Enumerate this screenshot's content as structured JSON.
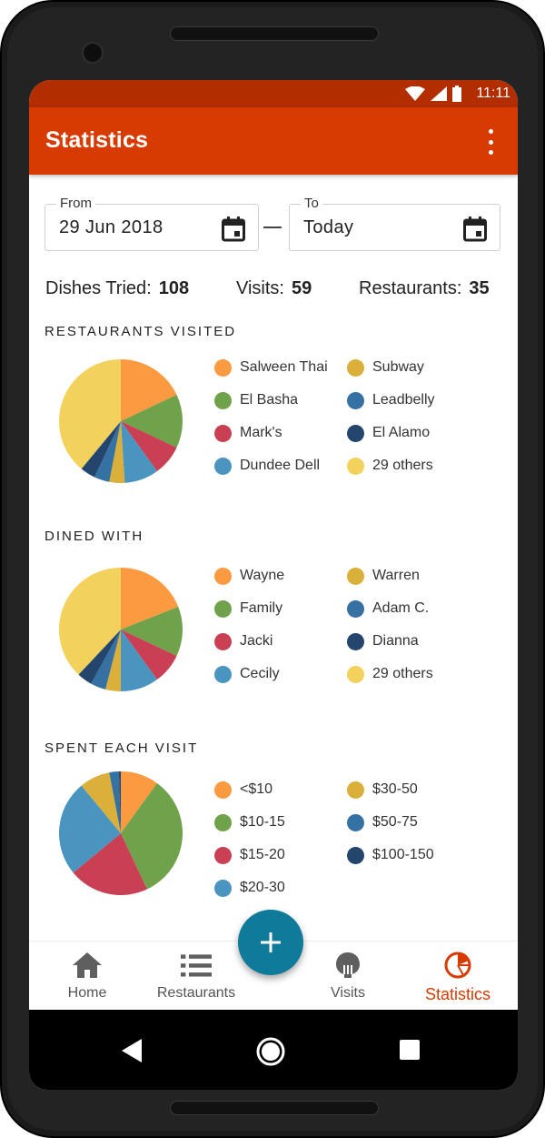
{
  "status": {
    "time": "11:11"
  },
  "app_bar": {
    "title": "Statistics"
  },
  "filters": {
    "from_label": "From",
    "from_value": "29 Jun 2018",
    "to_label": "To",
    "to_value": "Today"
  },
  "counts": {
    "dishes_label": "Dishes Tried:",
    "dishes_value": "108",
    "visits_label": "Visits:",
    "visits_value": "59",
    "restaurants_label": "Restaurants:",
    "restaurants_value": "35"
  },
  "chart_data": [
    {
      "type": "pie",
      "title": "RESTAURANTS VISITED",
      "series": [
        {
          "name": "Salween Thai",
          "value": 18,
          "color": "#fb9a40"
        },
        {
          "name": "El Basha",
          "value": 14,
          "color": "#70a24b"
        },
        {
          "name": "Mark's",
          "value": 8,
          "color": "#c94054"
        },
        {
          "name": "Dundee Dell",
          "value": 9,
          "color": "#4a94c0"
        },
        {
          "name": "Subway",
          "value": 4,
          "color": "#dbb03a"
        },
        {
          "name": "Leadbelly",
          "value": 4,
          "color": "#3571a2"
        },
        {
          "name": "El Alamo",
          "value": 4,
          "color": "#24466d"
        },
        {
          "name": "29 others",
          "value": 39,
          "color": "#f3d15d"
        }
      ]
    },
    {
      "type": "pie",
      "title": "DINED WITH",
      "series": [
        {
          "name": "Wayne",
          "value": 19,
          "color": "#fb9a40"
        },
        {
          "name": "Family",
          "value": 13,
          "color": "#70a24b"
        },
        {
          "name": "Jacki",
          "value": 8,
          "color": "#c94054"
        },
        {
          "name": "Cecily",
          "value": 10,
          "color": "#4a94c0"
        },
        {
          "name": "Warren",
          "value": 4,
          "color": "#dbb03a"
        },
        {
          "name": "Adam C.",
          "value": 4,
          "color": "#3571a2"
        },
        {
          "name": "Dianna",
          "value": 4,
          "color": "#24466d"
        },
        {
          "name": "29 others",
          "value": 38,
          "color": "#f3d15d"
        }
      ]
    },
    {
      "type": "pie",
      "title": "SPENT EACH VISIT",
      "series": [
        {
          "name": "<$10",
          "value": 10,
          "color": "#fb9a40"
        },
        {
          "name": "$10-15",
          "value": 33,
          "color": "#70a24b"
        },
        {
          "name": "$15-20",
          "value": 21,
          "color": "#c94054"
        },
        {
          "name": "$20-30",
          "value": 25,
          "color": "#4a94c0"
        },
        {
          "name": "$30-50",
          "value": 8,
          "color": "#dbb03a"
        },
        {
          "name": "$50-75",
          "value": 2.5,
          "color": "#3571a2"
        },
        {
          "name": "$100-150",
          "value": 0.5,
          "color": "#24466d"
        }
      ]
    }
  ],
  "legends": [
    {
      "left_col": [
        "Salween Thai",
        "El Basha",
        "Mark's",
        "Dundee Dell"
      ],
      "right_col": [
        "Subway",
        "Leadbelly",
        "El Alamo",
        "29 others"
      ]
    },
    {
      "left_col": [
        "Wayne",
        "Family",
        "Jacki",
        "Cecily"
      ],
      "right_col": [
        "Warren",
        "Adam C.",
        "Dianna",
        "29 others"
      ]
    },
    {
      "left_col": [
        "<$10",
        "$10-15",
        "$15-20",
        "$20-30"
      ],
      "right_col": [
        "$30-50",
        "$50-75",
        "$100-150"
      ]
    }
  ],
  "bottom_nav": {
    "items": [
      {
        "label": "Home",
        "icon": "home-icon"
      },
      {
        "label": "Restaurants",
        "icon": "list-icon"
      },
      {
        "label": "Visits",
        "icon": "utensils-icon"
      },
      {
        "label": "Statistics",
        "icon": "pie-chart-icon"
      }
    ],
    "active": "Statistics",
    "fab_icon": "plus-icon"
  },
  "colors": {
    "primary": "#d83b01",
    "status_bar": "#b22d00",
    "fab": "#0f7a9a"
  }
}
